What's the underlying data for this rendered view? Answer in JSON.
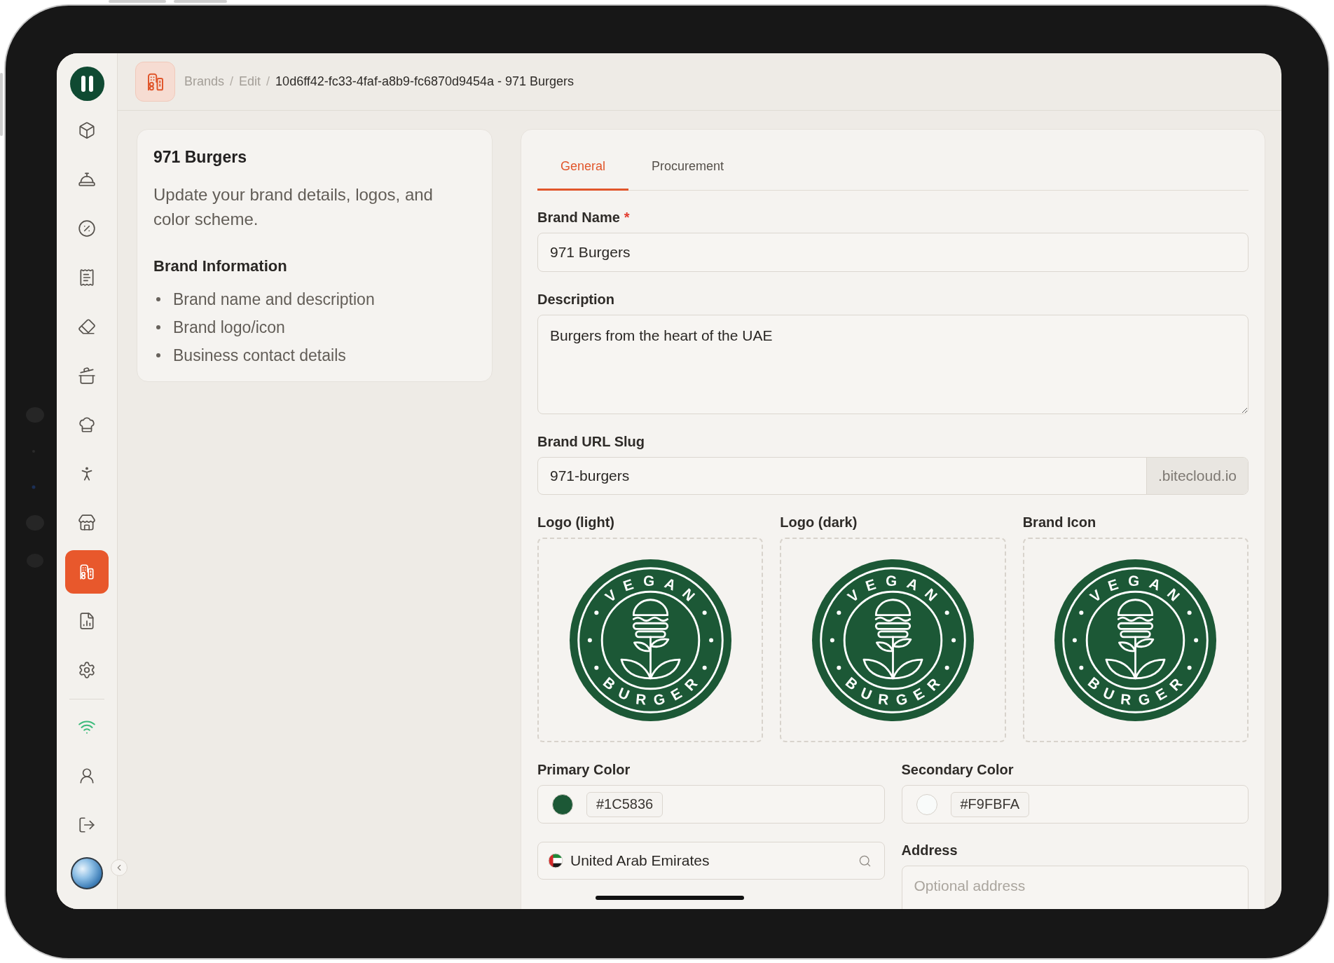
{
  "sidebar": {
    "nav_items": [
      {
        "selected": false
      },
      {
        "selected": false
      },
      {
        "selected": false
      },
      {
        "selected": false
      },
      {
        "selected": false
      },
      {
        "selected": false
      },
      {
        "selected": false
      },
      {
        "selected": false
      },
      {
        "selected": false
      },
      {
        "selected": true
      },
      {
        "selected": false
      },
      {
        "selected": false
      }
    ],
    "network": {
      "online": true
    }
  },
  "header": {
    "breadcrumb": [
      {
        "label": "Brands",
        "current": false,
        "separator": "/"
      },
      {
        "label": "Edit",
        "current": false,
        "separator": "/"
      },
      {
        "label": "10d6ff42-fc33-4faf-a8b9-fc6870d9454a - 971 Burgers",
        "current": true
      }
    ]
  },
  "info_card": {
    "title": "971 Burgers",
    "description": "Update your brand details, logos, and color scheme.",
    "section_title": "Brand Information",
    "bullets": [
      "Brand name and description",
      "Brand logo/icon",
      "Business contact details"
    ]
  },
  "form": {
    "tabs": [
      {
        "label": "General",
        "selected": true
      },
      {
        "label": "Procurement",
        "selected": false
      }
    ],
    "brand_name": {
      "label": "Brand Name",
      "required_mark": "*",
      "value": "971 Burgers"
    },
    "description": {
      "label": "Description",
      "value": "Burgers from the heart of the UAE"
    },
    "url_slug": {
      "label": "Brand URL Slug",
      "value": "971-burgers",
      "suffix": ".bitecloud.io"
    },
    "logos": [
      {
        "label": "Logo (light)",
        "badge": {
          "top_text": "VEGAN",
          "bottom_text": "BURGER"
        }
      },
      {
        "label": "Logo (dark)",
        "badge": {
          "top_text": "VEGAN",
          "bottom_text": "BURGER"
        }
      },
      {
        "label": "Brand Icon",
        "badge": {
          "top_text": "VEGAN",
          "bottom_text": "BURGER"
        }
      }
    ],
    "colors": [
      {
        "label": "Primary Color",
        "value": "#1C5836",
        "color": "#1c5836"
      },
      {
        "label": "Secondary Color",
        "value": "#F9FBFA",
        "color": "#f9fbfa"
      }
    ],
    "country": {
      "value": "United Arab Emirates"
    },
    "address": {
      "label": "Address",
      "placeholder": "Optional address"
    }
  }
}
